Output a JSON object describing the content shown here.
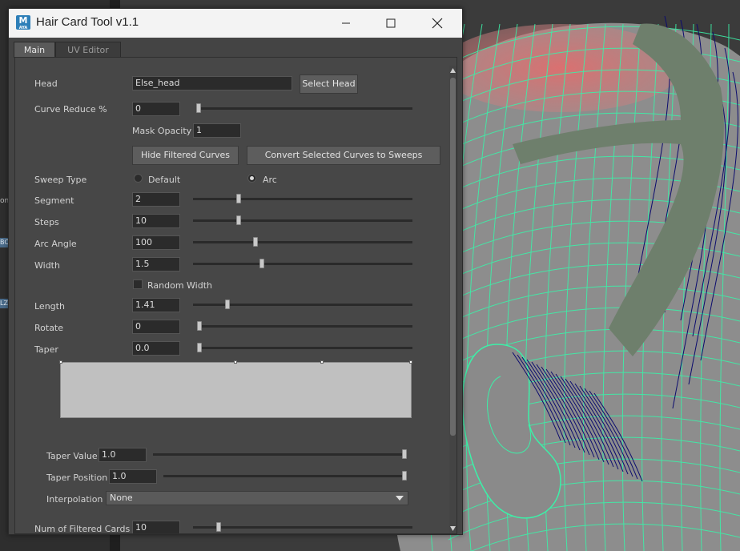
{
  "window": {
    "title": "Hair Card Tool v1.1",
    "icon_letter": "M",
    "icon_sub": "AYA",
    "controls": {
      "minimize_icon": "minimize-icon",
      "maximize_icon": "maximize-icon",
      "close_icon": "close-icon"
    }
  },
  "tabs": [
    {
      "label": "Main",
      "active": true
    },
    {
      "label": "UV Editor",
      "active": false
    }
  ],
  "form": {
    "head": {
      "label": "Head",
      "value": "Else_head",
      "button": "Select Head"
    },
    "curve_reduce": {
      "label": "Curve Reduce %",
      "value": "0",
      "slider": 0.0
    },
    "mask_opacity": {
      "label": "Mask Opacity",
      "value": "1"
    },
    "hide_filtered_button": "Hide Filtered Curves",
    "convert_button": "Convert Selected Curves to Sweeps",
    "sweep_type": {
      "label": "Sweep Type",
      "options": [
        "Default",
        "Arc"
      ],
      "selected": "Arc"
    },
    "segment": {
      "label": "Segment",
      "value": "2",
      "slider": 0.2
    },
    "steps": {
      "label": "Steps",
      "value": "10",
      "slider": 0.2
    },
    "arc_angle": {
      "label": "Arc Angle",
      "value": "100",
      "slider": 0.28
    },
    "width": {
      "label": "Width",
      "value": "1.5",
      "slider": 0.31
    },
    "random_width": {
      "label": "Random Width",
      "checked": false
    },
    "length": {
      "label": "Length",
      "value": "1.41",
      "slider": 0.15
    },
    "rotate": {
      "label": "Rotate",
      "value": "0",
      "slider": 0.0
    },
    "taper": {
      "label": "Taper",
      "value": "0.0",
      "slider": 0.0
    },
    "taper_value": {
      "label": "Taper Value",
      "value": "1.0",
      "slider": 1.0
    },
    "taper_position": {
      "label": "Taper Position",
      "value": "1.0",
      "slider": 1.0
    },
    "interpolation": {
      "label": "Interpolation",
      "value": "None"
    },
    "num_filtered_cards": {
      "label": "Num of Filtered Cards",
      "value": "10",
      "slider": 0.11
    }
  },
  "left_fragments": [
    "on",
    "BC",
    "LZ"
  ],
  "colors": {
    "wireframe": "#3cf0a8",
    "hair_strands": "#0c0c6e",
    "scalp_mask": "#e06868",
    "sweep_card": "#6e7f6c",
    "viewport_bg": "#3b3b3b"
  }
}
